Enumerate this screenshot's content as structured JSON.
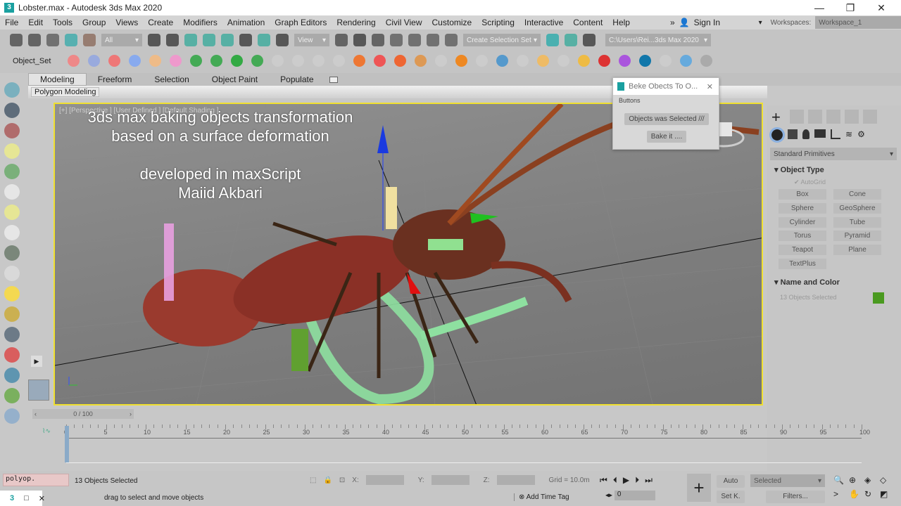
{
  "window": {
    "title": "Lobster.max - Autodesk 3ds Max 2020",
    "app_icon": "3",
    "minimize": "—",
    "restore": "❐",
    "close": "✕"
  },
  "menu": [
    "File",
    "Edit",
    "Tools",
    "Group",
    "Views",
    "Create",
    "Modifiers",
    "Animation",
    "Graph Editors",
    "Rendering",
    "Civil View",
    "Customize",
    "Scripting",
    "Interactive",
    "Content",
    "Help"
  ],
  "account": {
    "overflow": "»",
    "sign_in": "Sign In",
    "workspaces_label": "Workspaces:",
    "workspace": "Workspace_1"
  },
  "toolbar": {
    "selection_filter": "All",
    "ref_coord": "View",
    "selection_set": "Create Selection Set",
    "project_path": "C:\\Users\\Rei...3ds Max 2020",
    "icons": [
      "undo-icon",
      "redo-icon",
      "link-icon",
      "unlink-icon",
      "bind-space-warp-icon",
      "select-object-icon",
      "select-by-name-icon",
      "rect-region-icon",
      "window-crossing-icon",
      "move-icon",
      "rotate-icon",
      "scale-icon",
      "pivot-icon",
      "mirror-icon",
      "align-icon",
      "snap-3d-icon",
      "angle-snap-icon",
      "percent-snap-icon",
      "spinner-snap-icon",
      "edit-named-selection-icon",
      "mirror2-icon",
      "align2-icon",
      "scene-explorer-icon"
    ]
  },
  "toolbar2": {
    "label": "Object_Set",
    "icons": [
      "fire-hex-icon",
      "ice-hex-icon",
      "fire-circle-icon",
      "water-icon",
      "bubbles-icon",
      "box-icon",
      "network-icon",
      "arrow-icon",
      "checker-icon",
      "burst-icon",
      "play-icon",
      "pause-icon",
      "square-icon",
      "trash-icon",
      "flame-icon",
      "flame2-icon",
      "flame3-icon",
      "smoke-icon",
      "liquid-icon",
      "candle-icon",
      "steam-icon",
      "splash-icon",
      "cup-icon",
      "mug-icon",
      "coffee-icon",
      "pour-icon",
      "tree-icon",
      "purple-icon",
      "power-icon",
      "ghost-icon",
      "ocean-icon",
      "help-icon"
    ]
  },
  "ribbon": {
    "tabs": [
      "Modeling",
      "Freeform",
      "Selection",
      "Object Paint",
      "Populate"
    ],
    "active": "Modeling",
    "panel": "Polygon Modeling"
  },
  "viewport": {
    "label": "[+] [Perspective ] [User Defined ] [Default Shading ]",
    "overlay_line1": "3ds max baking objects transformation",
    "overlay_line2": "based on a surface deformation",
    "overlay_line3": "developed in maxScript",
    "overlay_line4": "Maiid Akbari"
  },
  "dialog": {
    "title": "Beke Obects To O...",
    "close": "✕",
    "group": "Buttons",
    "button1": "Objects was Selected ///",
    "button2": "Bake it ...."
  },
  "command_panel": {
    "category": "Standard Primitives",
    "object_type": "Object Type",
    "autogrid": "AutoGrid",
    "primitives": [
      "Box",
      "Cone",
      "Sphere",
      "GeoSphere",
      "Cylinder",
      "Tube",
      "Torus",
      "Pyramid",
      "Teapot",
      "Plane",
      "TextPlus"
    ],
    "name_and_color": "Name and Color",
    "name_value": "13 Objects Selected",
    "color": "#4a9a20"
  },
  "timeline": {
    "frame": "0 / 100",
    "ticks": [
      "0",
      "5",
      "10",
      "15",
      "20",
      "25",
      "30",
      "35",
      "40",
      "45",
      "50",
      "55",
      "60",
      "65",
      "70",
      "75",
      "80",
      "85",
      "90",
      "95",
      "100"
    ]
  },
  "status": {
    "maxscript": "polyop.",
    "selected": "13 Objects Selected",
    "prompt": "drag to select and move objects",
    "x_label": "X:",
    "y_label": "Y:",
    "z_label": "Z:",
    "grid": "Grid = 10.0m",
    "add_time_tag": "Add Time Tag",
    "auto": "Auto",
    "setk": "Set K.",
    "key_filter": "Selected",
    "filters": "Filters...",
    "frame_spinner": "0"
  }
}
